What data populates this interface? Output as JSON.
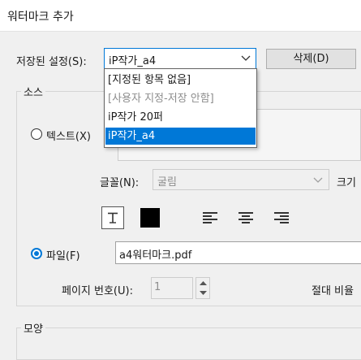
{
  "window": {
    "title": "워터마크 추가"
  },
  "saved_settings": {
    "label": "저장된 설정(S):",
    "value": "iP작가_a4",
    "delete_label": "삭제(D)",
    "options": [
      "[지정된 항목 없음]",
      "[사용자 지정-저장 안함]",
      "iP작가 20퍼",
      "iP작가_a4"
    ],
    "selected_index": 3
  },
  "source": {
    "group_title": "소스",
    "text_radio_label": "텍스트(X)",
    "font_label": "글꼴(N):",
    "font_value": "굴림",
    "size_label": "크기",
    "file_radio_label": "파일(F)",
    "file_value": "a4워터마크.pdf",
    "page_number_label": "페이지 번호(U):",
    "page_number_value": "1",
    "absolute_scale_label": "절대 비율"
  },
  "appearance": {
    "group_title": "모양"
  },
  "colors": {
    "accent": "#0078d7",
    "swatch": "#000000"
  },
  "icons": [
    "text-format-icon",
    "align-left-icon",
    "align-center-icon",
    "align-right-icon",
    "chevron-down-icon",
    "spin-up-icon",
    "spin-down-icon"
  ]
}
